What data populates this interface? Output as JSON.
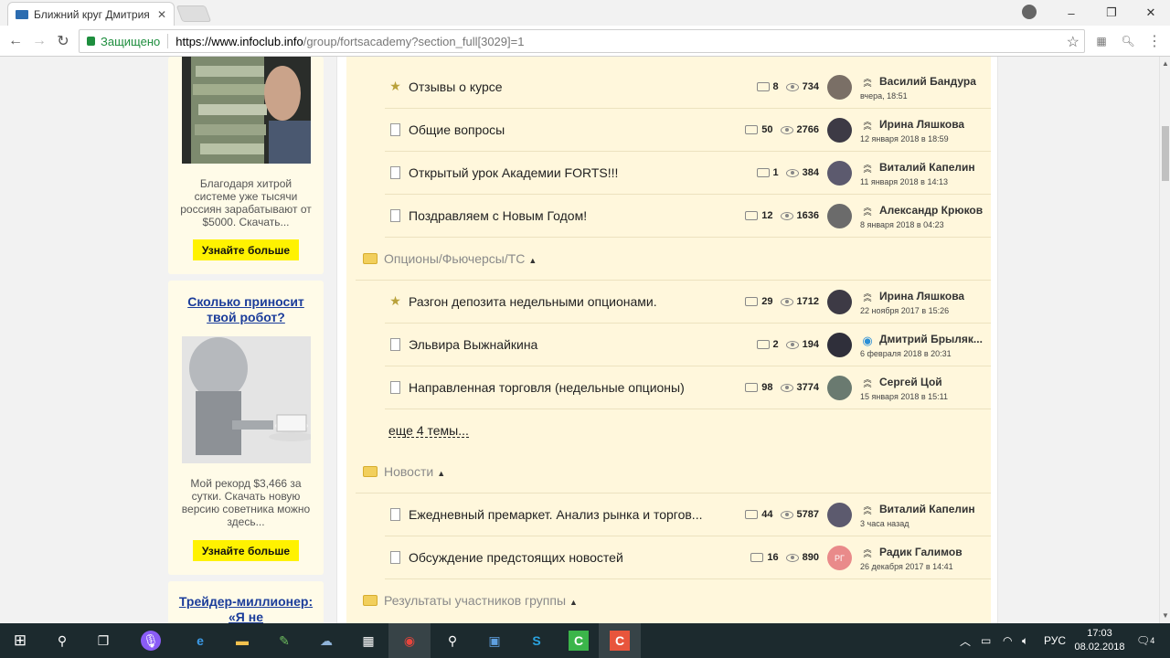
{
  "browser": {
    "tab_title": "Ближний круг Дмитрия",
    "tab_close": "✕",
    "security_label": "Защищено",
    "url_host": "https://www.infoclub.info",
    "url_path": "/group/fortsacademy?section_full[3029]=1",
    "minimize": "–",
    "restore": "❐",
    "close": "✕"
  },
  "ads": [
    {
      "text": "Благодаря хитрой системе уже тысячи россиян зарабатывают от $5000. Скачать...",
      "button": "Узнайте больше"
    },
    {
      "headline": "Сколько приносит твой робот?",
      "text": "Мой рекорд $3,466 за сутки. Скачать новую версию советника можно здесь...",
      "button": "Узнайте больше"
    },
    {
      "headline": "Трейдер-миллионер: «Я не"
    }
  ],
  "forum": {
    "rows": [
      {
        "kind": "topic",
        "icon": "star",
        "title": "Отзывы о курсе",
        "replies": "8",
        "views": "734",
        "author": "Василий Бандура",
        "date": "вчера, 18:51"
      },
      {
        "kind": "topic",
        "icon": "doc",
        "title": "Общие вопросы",
        "replies": "50",
        "views": "2766",
        "author": "Ирина Ляшкова",
        "date": "12 января 2018 в 18:59"
      },
      {
        "kind": "topic",
        "icon": "doc",
        "title": "Открытый урок Академии FORTS!!!",
        "replies": "1",
        "views": "384",
        "author": "Виталий Капелин",
        "date": "11 января 2018 в 14:13"
      },
      {
        "kind": "topic",
        "icon": "doc",
        "title": "Поздравляем с Новым Годом!",
        "replies": "12",
        "views": "1636",
        "author": "Александр Крюков",
        "date": "8 января 2018 в 04:23"
      },
      {
        "kind": "section",
        "title": "Опционы/Фьючерсы/ТС",
        "arrow": "▲"
      },
      {
        "kind": "topic",
        "icon": "star",
        "title": "Разгон депозита недельными опционами.",
        "replies": "29",
        "views": "1712",
        "author": "Ирина Ляшкова",
        "date": "22 ноября 2017 в 15:26"
      },
      {
        "kind": "topic",
        "icon": "doc",
        "title": "Эльвира Выжнайкина",
        "replies": "2",
        "views": "194",
        "author": "Дмитрий Брыляк...",
        "date": "6 февраля 2018 в 20:31"
      },
      {
        "kind": "topic",
        "icon": "doc",
        "title": "Направленная торговля (недельные опционы)",
        "replies": "98",
        "views": "3774",
        "author": "Сергей Цой",
        "date": "15 января 2018 в 15:11"
      },
      {
        "kind": "more",
        "title": "еще 4 темы..."
      },
      {
        "kind": "section",
        "title": "Новости",
        "arrow": "▲"
      },
      {
        "kind": "topic",
        "icon": "doc",
        "title": "Ежедневный премаркет. Анализ рынка и торгов...",
        "replies": "44",
        "views": "5787",
        "author": "Виталий Капелин",
        "date": "3 часа назад"
      },
      {
        "kind": "topic",
        "icon": "doc",
        "title": "Обсуждение предстоящих новостей",
        "replies": "16",
        "views": "890",
        "author": "Радик Галимов",
        "date": "26 декабря 2017 в 14:41",
        "avatar_initials": "РГ"
      },
      {
        "kind": "section",
        "title": "Результаты участников группы",
        "arrow": "▲"
      }
    ]
  },
  "taskbar": {
    "language": "РУС",
    "time": "17:03",
    "date": "08.02.2018",
    "notifications": "4"
  }
}
